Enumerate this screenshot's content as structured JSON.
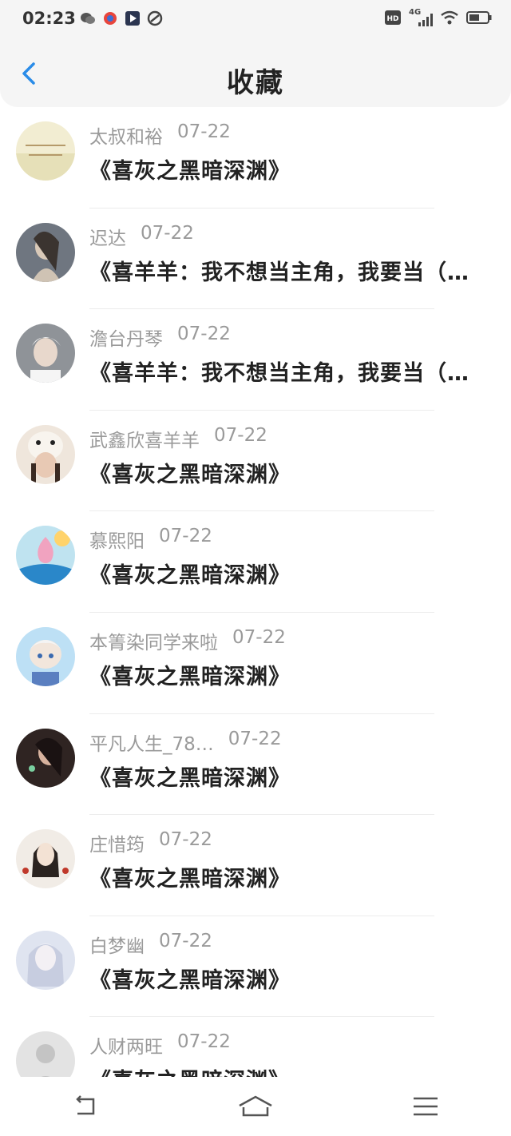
{
  "status_bar": {
    "time": "02:23",
    "network": "4G",
    "icons": [
      "wechat-icon",
      "app-red-icon",
      "video-app-icon",
      "app-swirl-icon",
      "hd-icon",
      "signal-icon",
      "wifi-icon",
      "battery-icon"
    ]
  },
  "header": {
    "title": "收藏",
    "back_icon": "chevron-left-icon"
  },
  "favorites": [
    {
      "user": "太叔和裕",
      "date": "07-22",
      "title": "《喜灰之黑暗深渊》"
    },
    {
      "user": "迟达",
      "date": "07-22",
      "title": "《喜羊羊：我不想当主角，我要当（…"
    },
    {
      "user": "澹台丹琴",
      "date": "07-22",
      "title": "《喜羊羊：我不想当主角，我要当（…"
    },
    {
      "user": "武鑫欣喜羊羊",
      "date": "07-22",
      "title": "《喜灰之黑暗深渊》"
    },
    {
      "user": "慕熙阳",
      "date": "07-22",
      "title": "《喜灰之黑暗深渊》"
    },
    {
      "user": "本箐染同学来啦",
      "date": "07-22",
      "title": "《喜灰之黑暗深渊》"
    },
    {
      "user": "平凡人生_78…",
      "date": "07-22",
      "title": "《喜灰之黑暗深渊》"
    },
    {
      "user": "庄惜筠",
      "date": "07-22",
      "title": "《喜灰之黑暗深渊》"
    },
    {
      "user": "白梦幽",
      "date": "07-22",
      "title": "《喜灰之黑暗深渊》"
    },
    {
      "user": "人财两旺",
      "date": "07-22",
      "title": "《喜灰之黑暗深渊》"
    }
  ],
  "nav_bar": {
    "icons": [
      "back-icon",
      "home-icon",
      "menu-icon"
    ]
  },
  "colors": {
    "accent": "#2a8ce8",
    "title_text": "#222222",
    "meta_text": "#9a9a9a",
    "header_bg": "#f5f5f5"
  }
}
